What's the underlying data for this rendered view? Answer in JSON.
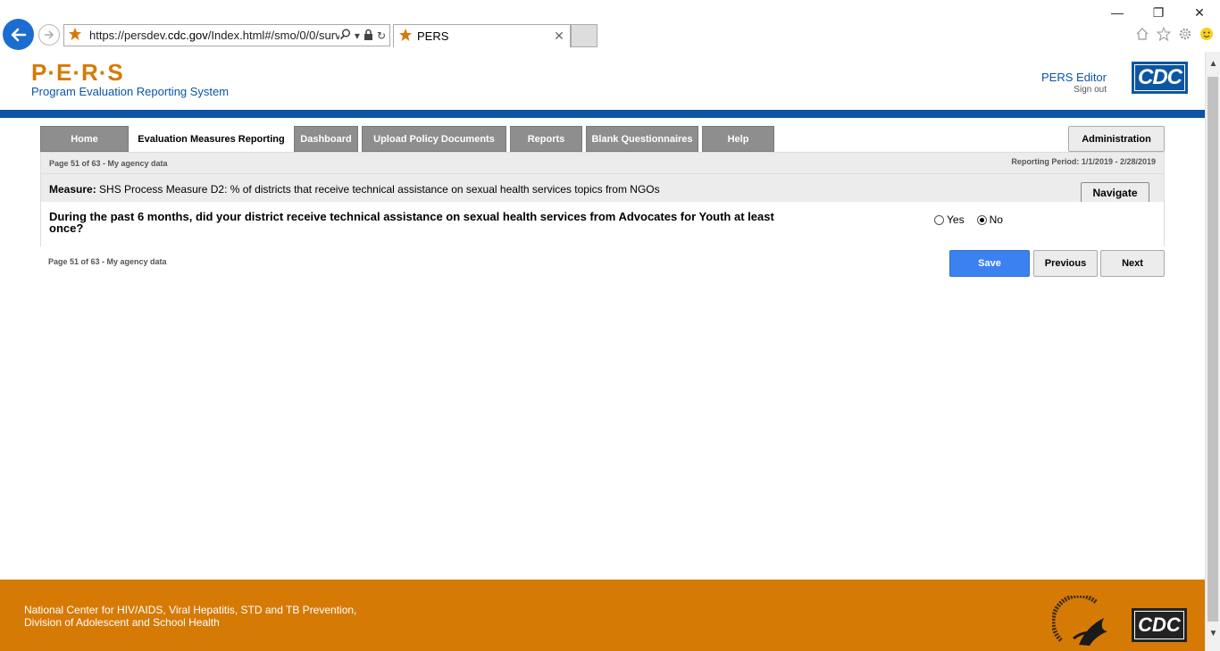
{
  "browser": {
    "url_prefix": "https://persdev.",
    "url_domain": "cdc.gov",
    "url_path": "/Index.html#/smo/0/0/surv",
    "tab_title": "PERS",
    "colors": {
      "back_button": "#1c6dd0"
    }
  },
  "header": {
    "logo": "P·E·R·S",
    "subtitle": "Program Evaluation Reporting System",
    "user_name": "PERS Editor",
    "sign_out": "Sign out",
    "cdc_logo": "CDC"
  },
  "menu": {
    "items": [
      {
        "label": "Home",
        "active": false
      },
      {
        "label": "Evaluation Measures Reporting",
        "active": true
      },
      {
        "label": "Dashboard",
        "active": false
      },
      {
        "label": "Upload Policy Documents",
        "active": false
      },
      {
        "label": "Reports",
        "active": false
      },
      {
        "label": "Blank Questionnaires",
        "active": false
      },
      {
        "label": "Help",
        "active": false
      }
    ],
    "admin_label": "Administration"
  },
  "page": {
    "page_info": "Page 51 of 63 - My agency data",
    "reporting_period": "Reporting Period: 1/1/2019 - 2/28/2019",
    "measure_label": "Measure:",
    "measure_text": "SHS Process Measure D2: % of districts that receive technical assistance on sexual health services topics from NGOs",
    "navigate_label": "Navigate",
    "question": "During the past 6 months, did your district receive technical assistance on sexual health services from Advocates for Youth at least once?",
    "options": [
      {
        "label": "Yes",
        "selected": false
      },
      {
        "label": "No",
        "selected": true
      }
    ],
    "footer_page_info": "Page 51 of 63 - My agency data",
    "save_label": "Save",
    "previous_label": "Previous",
    "next_label": "Next"
  },
  "footer": {
    "line1": "National Center for HIV/AIDS, Viral Hepatitis, STD and TB Prevention,",
    "line2": "Division of Adolescent and School Health",
    "cdc_logo": "CDC"
  },
  "colors": {
    "brand_orange": "#d67a06",
    "brand_blue": "#0b55a4",
    "menu_gray": "#8e8e8e",
    "save_blue": "#3b82f0"
  }
}
